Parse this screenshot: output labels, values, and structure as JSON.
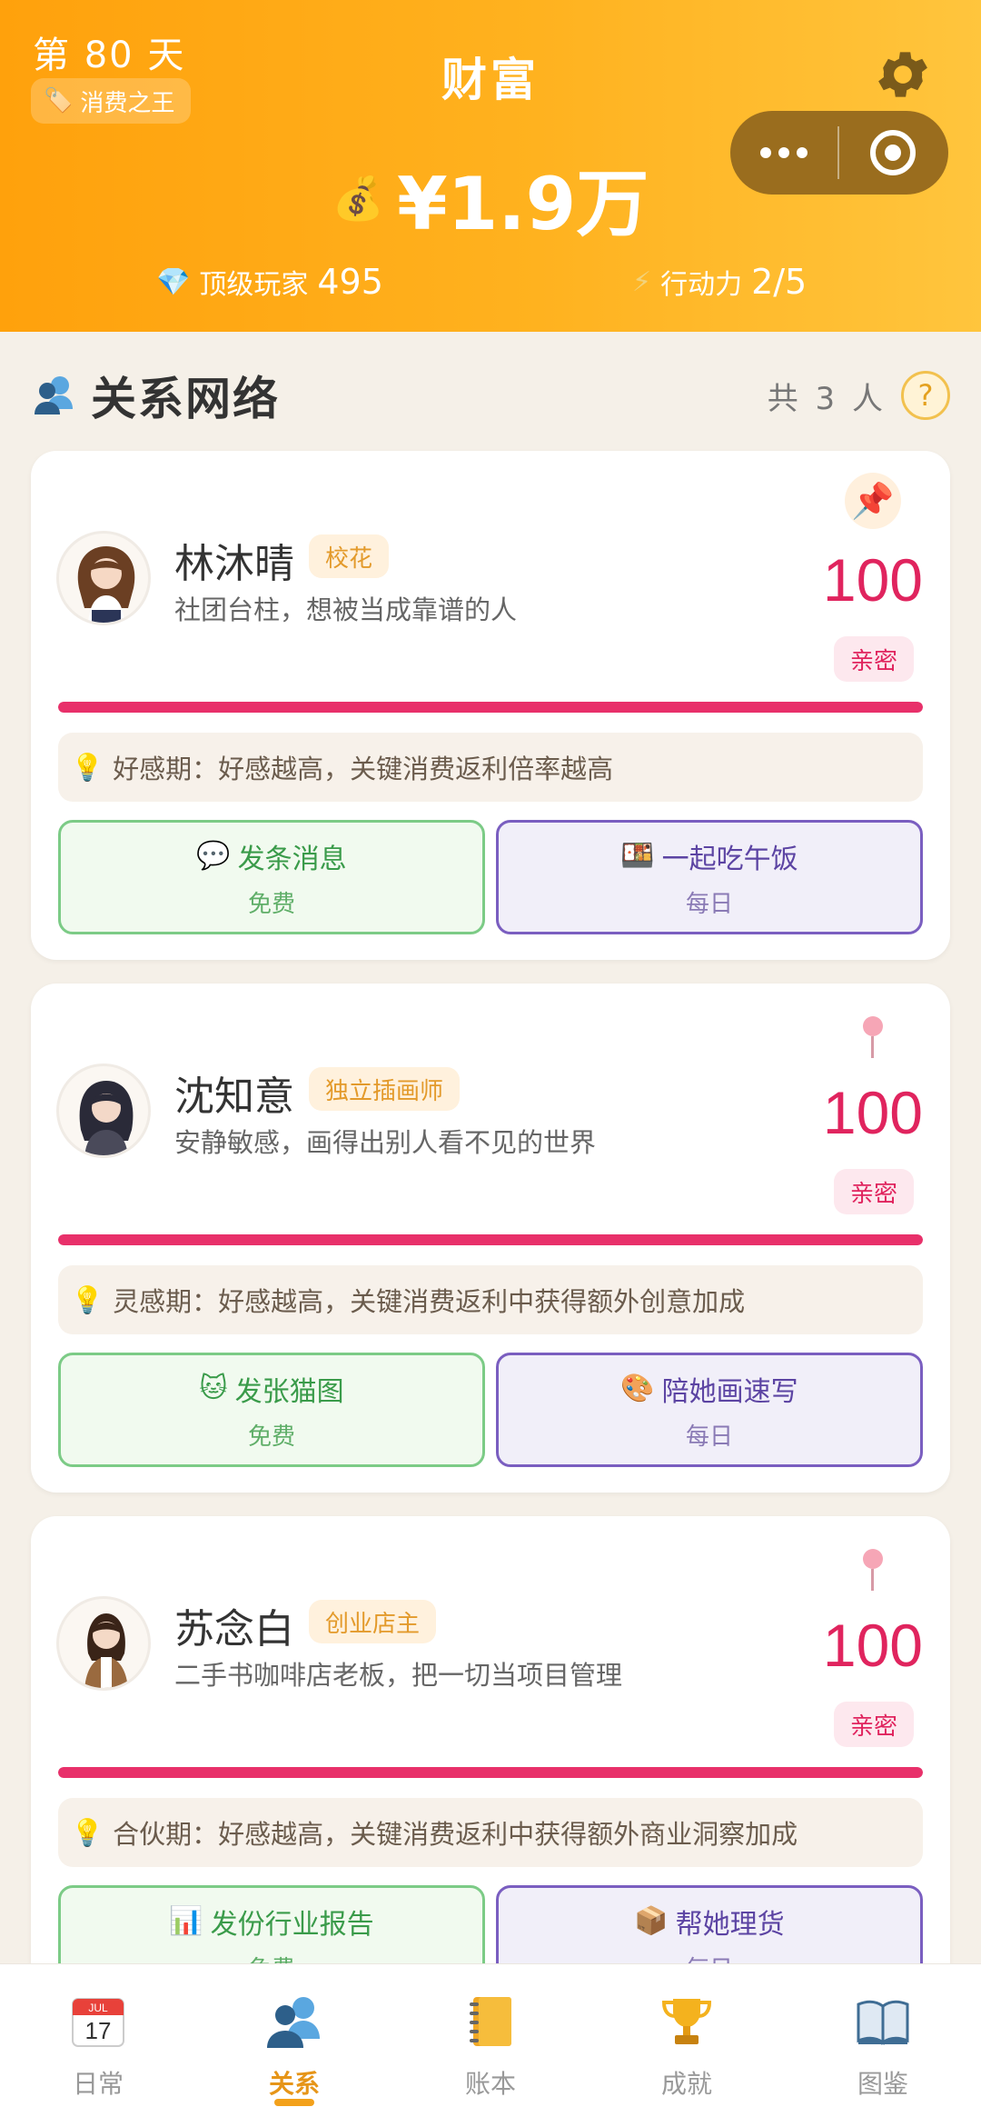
{
  "header": {
    "day": "第 80 天",
    "badge": "消费之王",
    "title": "财富",
    "wealth": "¥1.9万",
    "stat_player_label": "顶级玩家",
    "stat_player_value": "495",
    "stat_action_label": "行动力",
    "stat_action_value": "2/5"
  },
  "section": {
    "title": "关系网络",
    "count": "共 3 人",
    "help": "?"
  },
  "cards": [
    {
      "name": "林沐晴",
      "tag": "校花",
      "desc": "社团台柱，想被当成靠谱的人",
      "score": "100",
      "relation": "亲密",
      "progress": 1.0,
      "tip": "好感期：好感越高，关键消费返利倍率越高",
      "btn_free_label": "发条消息",
      "btn_free_sub": "免费",
      "btn_daily_label": "一起吃午饭",
      "btn_daily_sub": "每日"
    },
    {
      "name": "沈知意",
      "tag": "独立插画师",
      "desc": "安静敏感，画得出别人看不见的世界",
      "score": "100",
      "relation": "亲密",
      "progress": 1.0,
      "tip": "灵感期：好感越高，关键消费返利中获得额外创意加成",
      "btn_free_label": "发张猫图",
      "btn_free_sub": "免费",
      "btn_daily_label": "陪她画速写",
      "btn_daily_sub": "每日"
    },
    {
      "name": "苏念白",
      "tag": "创业店主",
      "desc": "二手书咖啡店老板，把一切当项目管理",
      "score": "100",
      "relation": "亲密",
      "progress": 1.0,
      "tip": "合伙期：好感越高，关键消费返利中获得额外商业洞察加成",
      "btn_free_label": "发份行业报告",
      "btn_free_sub": "免费",
      "btn_daily_label": "帮她理货",
      "btn_daily_sub": "每日"
    }
  ],
  "tabs": [
    {
      "label": "日常",
      "icon": "calendar-icon"
    },
    {
      "label": "关系",
      "icon": "people-icon"
    },
    {
      "label": "账本",
      "icon": "notebook-icon"
    },
    {
      "label": "成就",
      "icon": "trophy-icon"
    },
    {
      "label": "图鉴",
      "icon": "book-icon"
    }
  ],
  "calendar_text": "JUL",
  "calendar_day": "17",
  "colors": {
    "header_start": "#ffa10c",
    "header_end": "#ffc53d",
    "accent_pink": "#e0245e",
    "tab_active": "#e69518"
  }
}
